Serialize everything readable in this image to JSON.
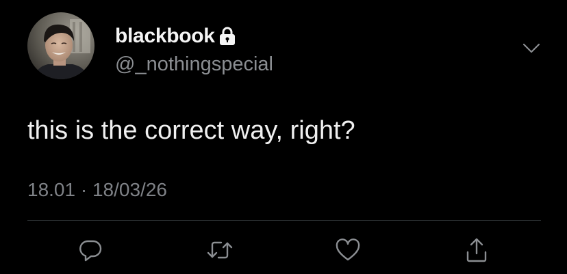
{
  "author": {
    "display_name": "blackbook",
    "handle": "@_nothingspecial",
    "protected": true
  },
  "tweet": {
    "text": "this is the correct way, right?",
    "time": "18.01",
    "separator": "·",
    "date": "18/03/26"
  },
  "icons": {
    "lock": "lock-icon",
    "menu": "chevron-down-icon",
    "reply": "reply-icon",
    "retweet": "retweet-icon",
    "like": "heart-icon",
    "share": "share-icon"
  },
  "colors": {
    "background": "#000000",
    "primary_text": "#f0f0f0",
    "secondary_text": "#7f8287",
    "divider": "#2f3336",
    "icon": "#8b8e92"
  }
}
